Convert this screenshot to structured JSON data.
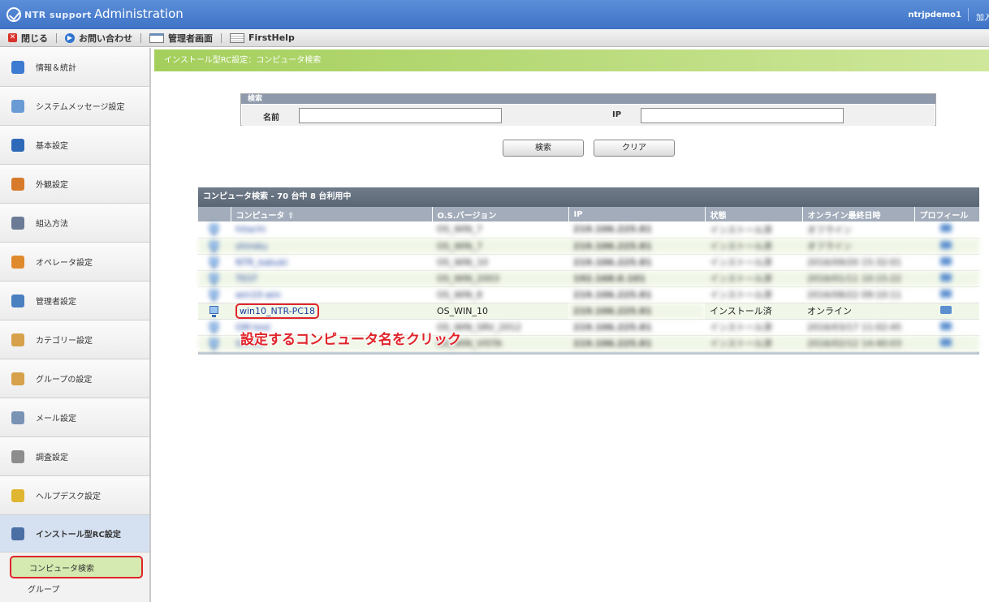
{
  "header": {
    "logo_text": "NTR support",
    "title": "Administration",
    "user": "ntrjpdemo1",
    "user_more": "加入"
  },
  "toolbar": {
    "close": "閉じる",
    "contact": "お問い合わせ",
    "admin_screen": "管理者画面",
    "first_help": "FirstHelp"
  },
  "sidebar": {
    "items": [
      {
        "label": "情報＆統計",
        "icon": "chart-icon",
        "color": "#3c7bd1"
      },
      {
        "label": "システムメッセージ設定",
        "icon": "message-icon",
        "color": "#6a9bd5"
      },
      {
        "label": "基本設定",
        "icon": "settings-icon",
        "color": "#2f6ab8"
      },
      {
        "label": "外観設定",
        "icon": "appearance-icon",
        "color": "#d77a2a"
      },
      {
        "label": "組込方法",
        "icon": "info-icon",
        "color": "#6b7b96"
      },
      {
        "label": "オペレータ設定",
        "icon": "operator-icon",
        "color": "#e08a2e"
      },
      {
        "label": "管理者設定",
        "icon": "admin-icon",
        "color": "#4a7fc0"
      },
      {
        "label": "カテゴリー設定",
        "icon": "category-icon",
        "color": "#d6a14a"
      },
      {
        "label": "グループの設定",
        "icon": "group-icon",
        "color": "#d6a14a"
      },
      {
        "label": "メール設定",
        "icon": "mail-icon",
        "color": "#7a93b5"
      },
      {
        "label": "調査設定",
        "icon": "survey-icon",
        "color": "#8d8d8d"
      },
      {
        "label": "ヘルプデスク設定",
        "icon": "helpdesk-icon",
        "color": "#e0b630"
      }
    ],
    "active": {
      "label": "インストール型RC設定",
      "icon": "computer-icon",
      "color": "#4a6fa5"
    },
    "subitems": [
      "コンピュータ検索",
      "グループ"
    ]
  },
  "breadcrumb": "インストール型RC設定：コンピュータ検索",
  "search": {
    "header": "検索",
    "name_label": "名前",
    "name_value": "",
    "ip_label": "IP",
    "ip_value": "",
    "search_button": "検索",
    "clear_button": "クリア"
  },
  "results": {
    "title": "コンピュータ検索 - 70 台中 8 台利用中",
    "columns": [
      "",
      "コンピュータ ⇧",
      "O.S.バージョン",
      "IP",
      "状態",
      "オンライン最終日時",
      "プロフィール"
    ],
    "rows": [
      {
        "name": "hitachi",
        "os": "OS_WIN_7",
        "ip": "219.106.225.81",
        "status": "インストール済",
        "last": "オフライン"
      },
      {
        "name": "shiroku",
        "os": "OS_WIN_7",
        "ip": "219.106.225.81",
        "status": "インストール済",
        "last": "オフライン"
      },
      {
        "name": "NTR_kabuki",
        "os": "OS_WIN_10",
        "ip": "219.106.225.81",
        "status": "インストール済",
        "last": "2016/09/20 15:32:01"
      },
      {
        "name": "TEST",
        "os": "OS_WIN_2003",
        "ip": "192.168.0.101",
        "status": "インストール済",
        "last": "2016/01/11 10:15:22"
      },
      {
        "name": "win10-win",
        "os": "OS_WIN_8",
        "ip": "219.106.225.81",
        "status": "インストール済",
        "last": "2016/08/22 09:10:11"
      },
      {
        "name": "win10_NTR-PC18",
        "os": "OS_WIN_10",
        "ip": "219.106.225.81",
        "status": "インストール済",
        "last": "オンライン"
      },
      {
        "name": "GM-test",
        "os": "OS_WIN_SRV_2012",
        "ip": "219.106.225.81",
        "status": "インストール済",
        "last": "2016/03/17 11:02:45"
      },
      {
        "name": "VM-01",
        "os": "OS_WIN_VISTA",
        "ip": "219.106.225.81",
        "status": "インストール済",
        "last": "2016/02/12 14:40:03"
      }
    ]
  },
  "annotation": "設定するコンピュータ名をクリック"
}
